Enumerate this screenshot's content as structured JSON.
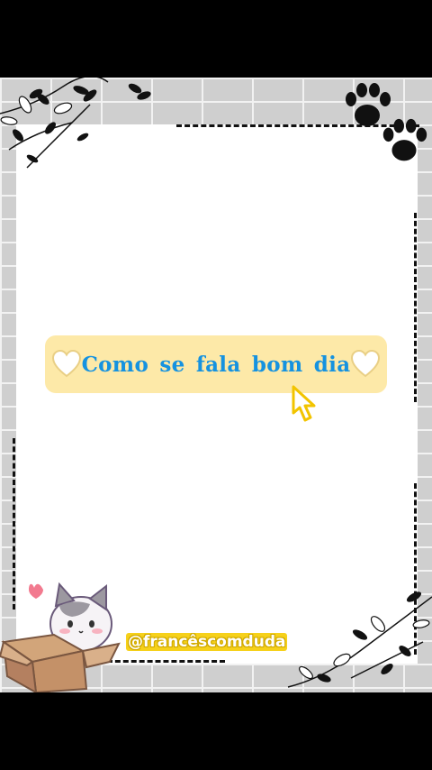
{
  "main": {
    "title": "Como se fala bom dia",
    "handle": "@francêscomduda"
  },
  "icons": [
    "heart-icon",
    "heart-icon",
    "cursor-icon",
    "paw-icon",
    "paw-icon",
    "flower-icon",
    "cat-in-box-icon"
  ],
  "colors": {
    "title_text": "#1592e0",
    "title_box": "#fde9a8",
    "handle_bg": "#f6d11b"
  }
}
